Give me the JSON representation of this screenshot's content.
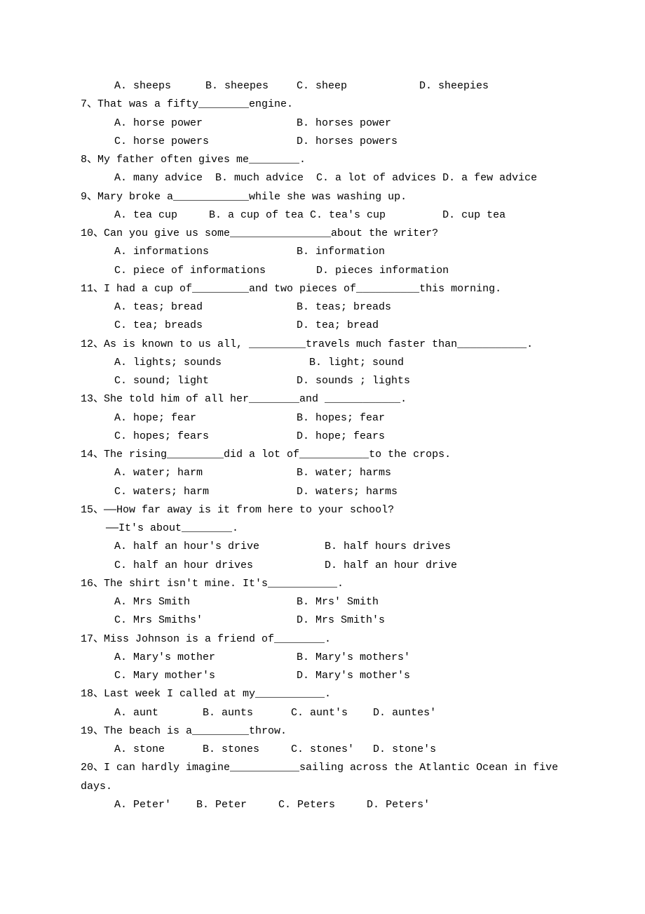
{
  "q6": {
    "options": [
      "A. sheeps",
      "B. sheepes",
      "C. sheep",
      "D. sheepies"
    ]
  },
  "q7": {
    "text": "7、That was a fifty________engine.",
    "opts1": [
      "A. horse power",
      "B. horses power"
    ],
    "opts2": [
      "C. horse powers",
      "D. horses powers"
    ]
  },
  "q8": {
    "text": "8、My father often gives me________.",
    "opts": [
      "A. many advice  B. much advice  C. a lot of advices D. a few advice"
    ]
  },
  "q9": {
    "text": "9、Mary broke a____________while she was washing up.",
    "opts": [
      "A. tea cup     B. a cup of tea C. tea's cup         D. cup tea"
    ]
  },
  "q10": {
    "text": "10、Can you give us some________________about the writer?",
    "opts1": [
      "A. informations",
      "B. information"
    ],
    "opts2": [
      "C. piece of informations        D. pieces information"
    ]
  },
  "q11": {
    "text": "11、I had a cup of_________and two pieces of__________this morning.",
    "opts1": [
      "A. teas; bread",
      "B. teas; breads"
    ],
    "opts2": [
      "C. tea; breads",
      "D. tea; bread"
    ]
  },
  "q12": {
    "text": "12、As is known to us all, _________travels much faster than___________.",
    "opts1": [
      "A. lights; sounds",
      "  B. light; sound"
    ],
    "opts2": [
      "C. sound; light",
      "D. sounds ; lights"
    ]
  },
  "q13": {
    "text": "13、She told him of all her________and ____________.",
    "opts1": [
      "A. hope; fear",
      "B. hopes; fear"
    ],
    "opts2": [
      "C. hopes; fears",
      "D. hope; fears"
    ]
  },
  "q14": {
    "text": "14、The rising_________did a lot of___________to the crops.",
    "opts1": [
      "A. water; harm",
      "B. water; harms"
    ],
    "opts2": [
      "C. waters; harm",
      "D. waters; harms"
    ]
  },
  "q15": {
    "text1": "15、——How far away is it from here to your school?",
    "text2": "    ——It's about________.",
    "opts1": [
      "A. half an hour's drive",
      "B. half hours drives"
    ],
    "opts2": [
      "C. half an hour drives",
      "D. half an hour drive"
    ]
  },
  "q16": {
    "text": "16、The shirt isn't mine. It's___________.",
    "opts1": [
      "A. Mrs Smith",
      "B. Mrs' Smith"
    ],
    "opts2": [
      "C. Mrs Smiths'",
      "D. Mrs Smith's"
    ]
  },
  "q17": {
    "text": "17、Miss Johnson is a friend of________.",
    "opts1": [
      "A. Mary's mother",
      "B. Mary's mothers'"
    ],
    "opts2": [
      "C. Mary mother's",
      "D. Mary's mother's"
    ]
  },
  "q18": {
    "text": "18、Last week I called at my___________.",
    "opts": [
      "A. aunt       B. aunts      C. aunt's    D. auntes'"
    ]
  },
  "q19": {
    "text": "19、The beach is a_________throw.",
    "opts": [
      "A. stone      B. stones     C. stones'   D. stone's"
    ]
  },
  "q20": {
    "text1": "20、I can hardly imagine___________sailing across the Atlantic Ocean in five",
    "text2": "days.",
    "opts": [
      "A. Peter'    B. Peter     C. Peters     D. Peters'"
    ]
  }
}
